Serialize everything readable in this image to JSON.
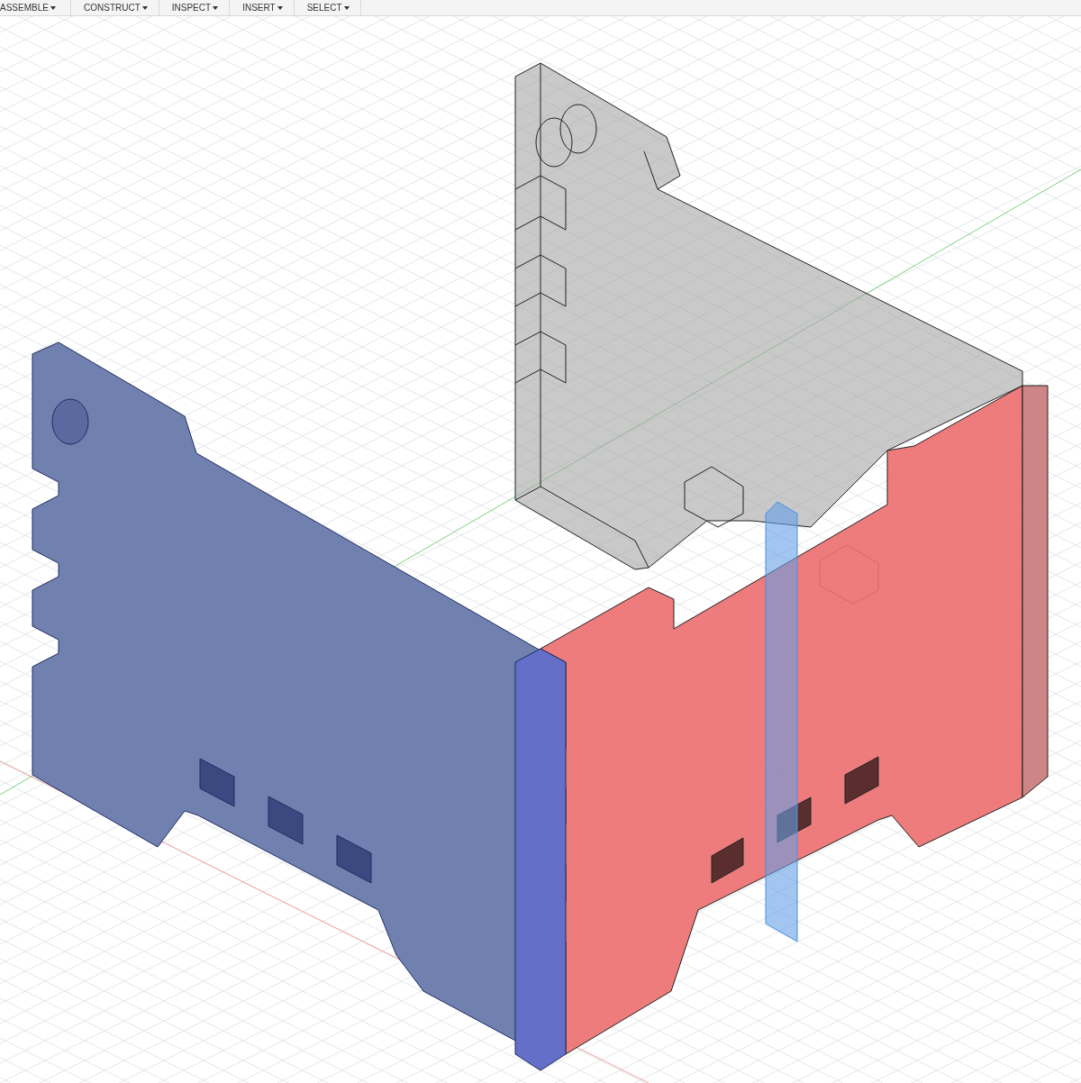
{
  "toolbar": {
    "menus": [
      {
        "label": "ASSEMBLE"
      },
      {
        "label": "CONSTRUCT"
      },
      {
        "label": "INSPECT"
      },
      {
        "label": "INSERT"
      },
      {
        "label": "SELECT"
      }
    ]
  }
}
